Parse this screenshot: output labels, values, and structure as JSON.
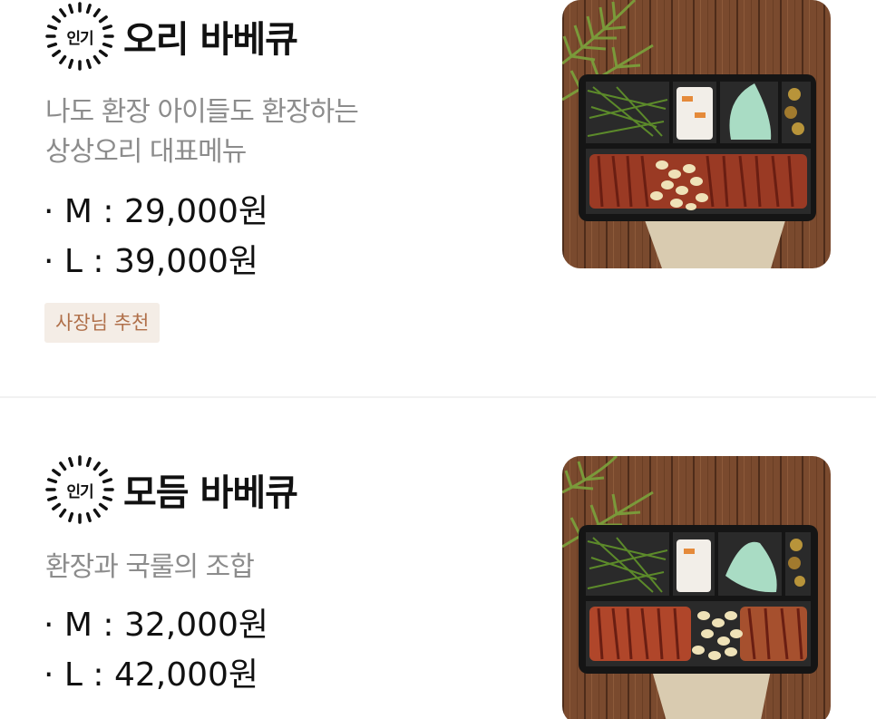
{
  "menu": {
    "items": [
      {
        "badge": "인기",
        "name": "오리 바베큐",
        "description_lines": [
          "나도 환장 아이들도 환장하는",
          "상상오리 대표메뉴"
        ],
        "prices": [
          "· M : 29,000원",
          "· L : 39,000원"
        ],
        "tag": "사장님 추천",
        "image_icon": "duck-bbq-photo"
      },
      {
        "badge": "인기",
        "name": "모듬 바베큐",
        "description_lines": [
          "환장과 국룰의 조합"
        ],
        "prices": [
          "· M : 32,000원",
          "· L : 42,000원"
        ],
        "tag": "",
        "image_icon": "mixed-bbq-photo"
      }
    ]
  },
  "colors": {
    "description": "#8c8c8c",
    "tag_background": "#f4ede6",
    "tag_text": "#b0704a",
    "divider": "#f1f1f1"
  }
}
